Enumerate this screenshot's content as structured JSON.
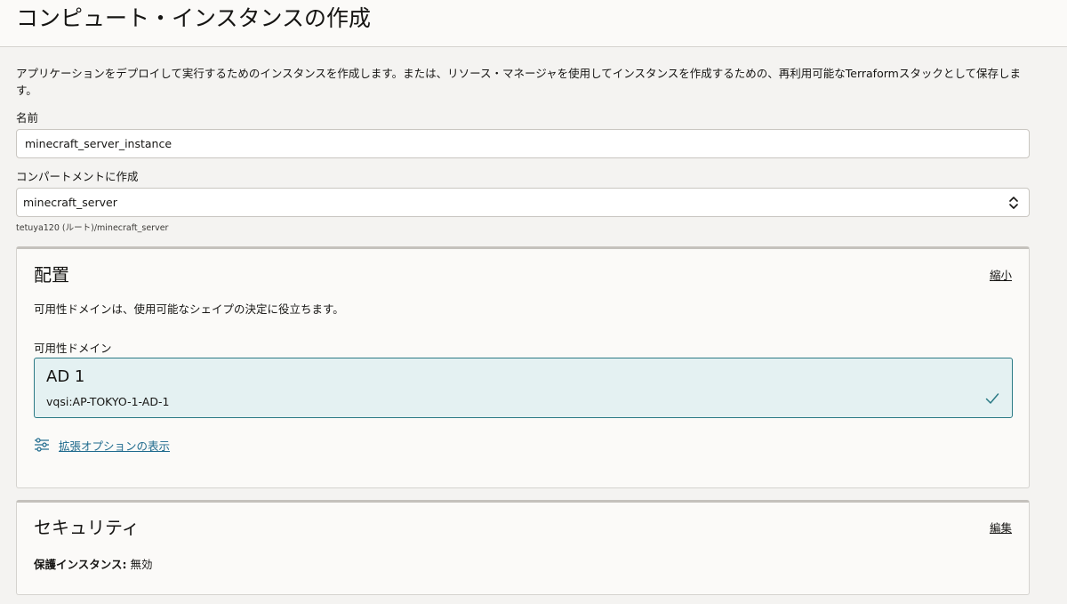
{
  "page": {
    "title": "コンピュート・インスタンスの作成",
    "intro": "アプリケーションをデプロイして実行するためのインスタンスを作成します。または、リソース・マネージャを使用してインスタンスを作成するための、再利用可能なTerraformスタックとして保存します。"
  },
  "name_field": {
    "label": "名前",
    "value": "minecraft_server_instance"
  },
  "compartment_field": {
    "label": "コンパートメントに作成",
    "value": "minecraft_server",
    "path": "tetuya120 (ルート)/minecraft_server",
    "arrow_icon": "chevron-up-down-icon"
  },
  "placement": {
    "title": "配置",
    "action": "縮小",
    "description": "可用性ドメインは、使用可能なシェイプの決定に役立ちます。",
    "ad_label": "可用性ドメイン",
    "selected_ad": {
      "name": "AD 1",
      "id": "vqsi:AP-TOKYO-1-AD-1",
      "selected": true
    },
    "advanced_options": "拡張オプションの表示",
    "advanced_icon": "sliders-icon",
    "accent_color": "#2b7a85",
    "link_color": "#1e6a8d"
  },
  "security": {
    "title": "セキュリティ",
    "action": "編集",
    "shielded_label": "保護インスタンス:",
    "shielded_value": "無効"
  }
}
